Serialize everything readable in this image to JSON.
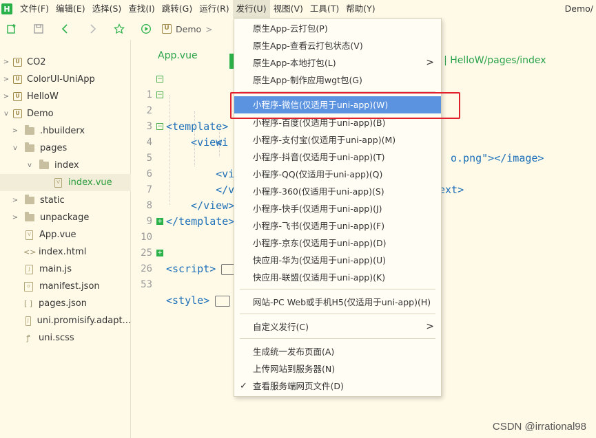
{
  "app": {
    "logo_text": "H",
    "window_title": "Demo/"
  },
  "menubar": {
    "items": [
      "文件(F)",
      "编辑(E)",
      "选择(S)",
      "查找(I)",
      "跳转(G)",
      "运行(R)",
      "发行(U)",
      "视图(V)",
      "工具(T)",
      "帮助(Y)"
    ]
  },
  "toolbar": {
    "breadcrumb_project": "Demo",
    "breadcrumb_sep": ">"
  },
  "sidebar": {
    "items": [
      {
        "label": "CO2",
        "type": "project"
      },
      {
        "label": "ColorUI-UniApp",
        "type": "project"
      },
      {
        "label": "HelloW",
        "type": "project"
      },
      {
        "label": "Demo",
        "type": "project"
      },
      {
        "label": ".hbuilderx",
        "type": "folder"
      },
      {
        "label": "pages",
        "type": "folder"
      },
      {
        "label": "index",
        "type": "folder"
      },
      {
        "label": "index.vue",
        "type": "file"
      },
      {
        "label": "static",
        "type": "folder"
      },
      {
        "label": "unpackage",
        "type": "folder"
      },
      {
        "label": "App.vue",
        "type": "file"
      },
      {
        "label": "index.html",
        "type": "file"
      },
      {
        "label": "main.js",
        "type": "file"
      },
      {
        "label": "manifest.json",
        "type": "file"
      },
      {
        "label": "pages.json",
        "type": "file"
      },
      {
        "label": "uni.promisify.adapt...",
        "type": "file"
      },
      {
        "label": "uni.scss",
        "type": "file"
      }
    ]
  },
  "editor": {
    "tab_label": "App.vue",
    "tab_path": "e | HelloW/pages/index",
    "lines": [
      {
        "num": "1",
        "text": "<template>"
      },
      {
        "num": "2",
        "text": "  <view"
      },
      {
        "num": "3",
        "text": "    <i"
      },
      {
        "num": "4",
        "text": "    <vi"
      },
      {
        "num": "5",
        "text": ""
      },
      {
        "num": "6",
        "text": "    </v"
      },
      {
        "num": "7",
        "text": "  </view>"
      },
      {
        "num": "8",
        "text": "</template>"
      },
      {
        "num": "9",
        "text": ""
      },
      {
        "num": "10",
        "text": "<script>"
      },
      {
        "num": "25",
        "text": ""
      },
      {
        "num": "26",
        "text": "<style>"
      },
      {
        "num": "53",
        "text": ""
      }
    ],
    "peek_line3": "o.png\"></image>",
    "peek_line4": "ext>"
  },
  "dropdown": {
    "group1": [
      "原生App-云打包(P)",
      "原生App-查看云打包状态(V)",
      "原生App-本地打包(L)",
      "原生App-制作应用wgt包(G)"
    ],
    "group2": [
      "小程序-微信(仅适用于uni-app)(W)",
      "小程序-百度(仅适用于uni-app)(B)",
      "小程序-支付宝(仅适用于uni-app)(M)",
      "小程序-抖音(仅适用于uni-app)(T)",
      "小程序-QQ(仅适用于uni-app)(Q)",
      "小程序-360(仅适用于uni-app)(S)",
      "小程序-快手(仅适用于uni-app)(J)",
      "小程序-飞书(仅适用于uni-app)(F)",
      "小程序-京东(仅适用于uni-app)(D)",
      "快应用-华为(仅适用于uni-app)(U)",
      "快应用-联盟(仅适用于uni-app)(K)"
    ],
    "group3": [
      "网站-PC Web或手机H5(仅适用于uni-app)(H)"
    ],
    "group4": [
      "自定义发行(C)"
    ],
    "group5": [
      "生成统一发布页面(A)",
      "上传网站到服务器(N)",
      "查看服务端网页文件(D)"
    ],
    "highlight_color": "#5b93e0"
  },
  "watermark": "CSDN @irrational98"
}
